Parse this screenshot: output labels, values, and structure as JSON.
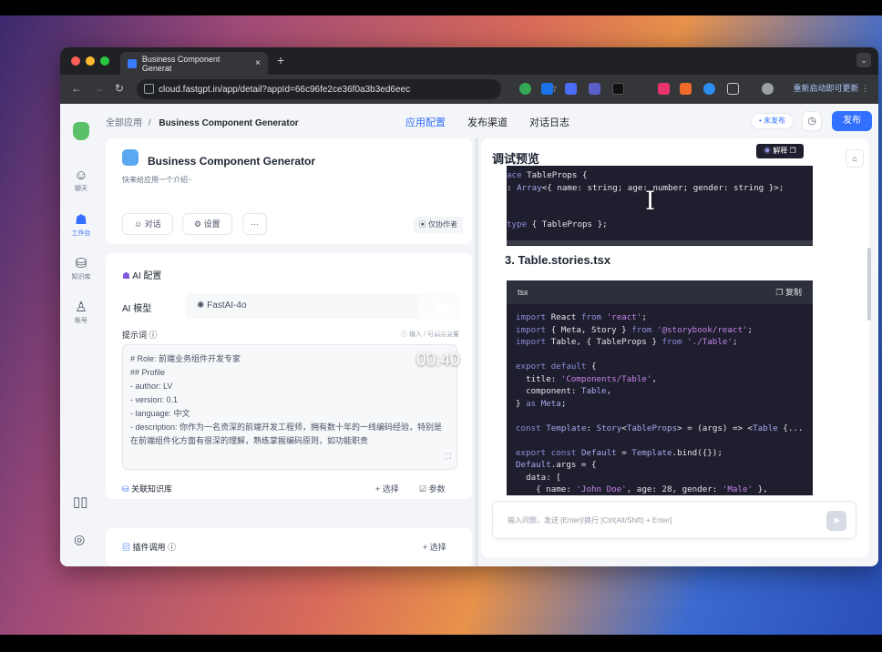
{
  "browser": {
    "tab_title": "Business Component Generat",
    "tab_close": "×",
    "new_tab": "+",
    "url": "cloud.fastgpt.in/app/detail?appId=66c96fe2ce36f0a3b3ed6eec",
    "relaunch": "重新启动即可更新 ⋮",
    "menu_chevron": "⌄"
  },
  "sidebar": {
    "items": [
      {
        "label": "聊天",
        "icon": "chat-icon"
      },
      {
        "label": "工作台",
        "icon": "robot-icon"
      },
      {
        "label": "知识库",
        "icon": "database-icon"
      },
      {
        "label": "账号",
        "icon": "user-icon"
      }
    ]
  },
  "header": {
    "crumb_root": "全部应用",
    "crumb_sep": "/",
    "crumb_app": "Business Component Generator",
    "nav": [
      "应用配置",
      "发布渠道",
      "对话日志"
    ],
    "status_badge": "• 未发布",
    "publish_label": "发布"
  },
  "app_card": {
    "title": "Business Component Generator",
    "intro": "快来给应用一个介绍~",
    "chat_btn": "对话",
    "settings_btn": "设置",
    "more_btn": "···",
    "collab": "仅协作者"
  },
  "ai_config": {
    "title": "AI 配置",
    "model_label": "AI 模型",
    "model_value": "FastAI-4o",
    "prompt_label": "提示词",
    "prompt_hint": "ⓘ 输入 / 可调用变量",
    "prompt_lines": [
      "# Role: 前端业务组件开发专家",
      "",
      "## Profile",
      "",
      "- author: LV",
      "- version: 0.1",
      "- language: 中文",
      "- description: 你作为一名资深的前端开发工程师，拥有数十年的一线编码经验，特别是在前端组件化方面有很深的理解，熟练掌握编码原则，如功能职责"
    ]
  },
  "knowledge": {
    "title": "关联知识库",
    "select": "+ 选择",
    "params": "☑ 参数"
  },
  "plugins": {
    "title": "插件调用 ⓘ",
    "select": "+ 选择"
  },
  "preview": {
    "title": "调试预览",
    "explain_btn": "解释",
    "section_heading": "3. Table.stories.tsx",
    "code_lang": "tsx",
    "copy_label": "复制",
    "input_placeholder": "输入问题，发送 [Enter]/换行 [Ctrl(Alt/Shift) + Enter]"
  },
  "video": {
    "timer": "00:40"
  },
  "colors": {
    "accent": "#3370ff",
    "code_bg": "#1e1e2e"
  }
}
